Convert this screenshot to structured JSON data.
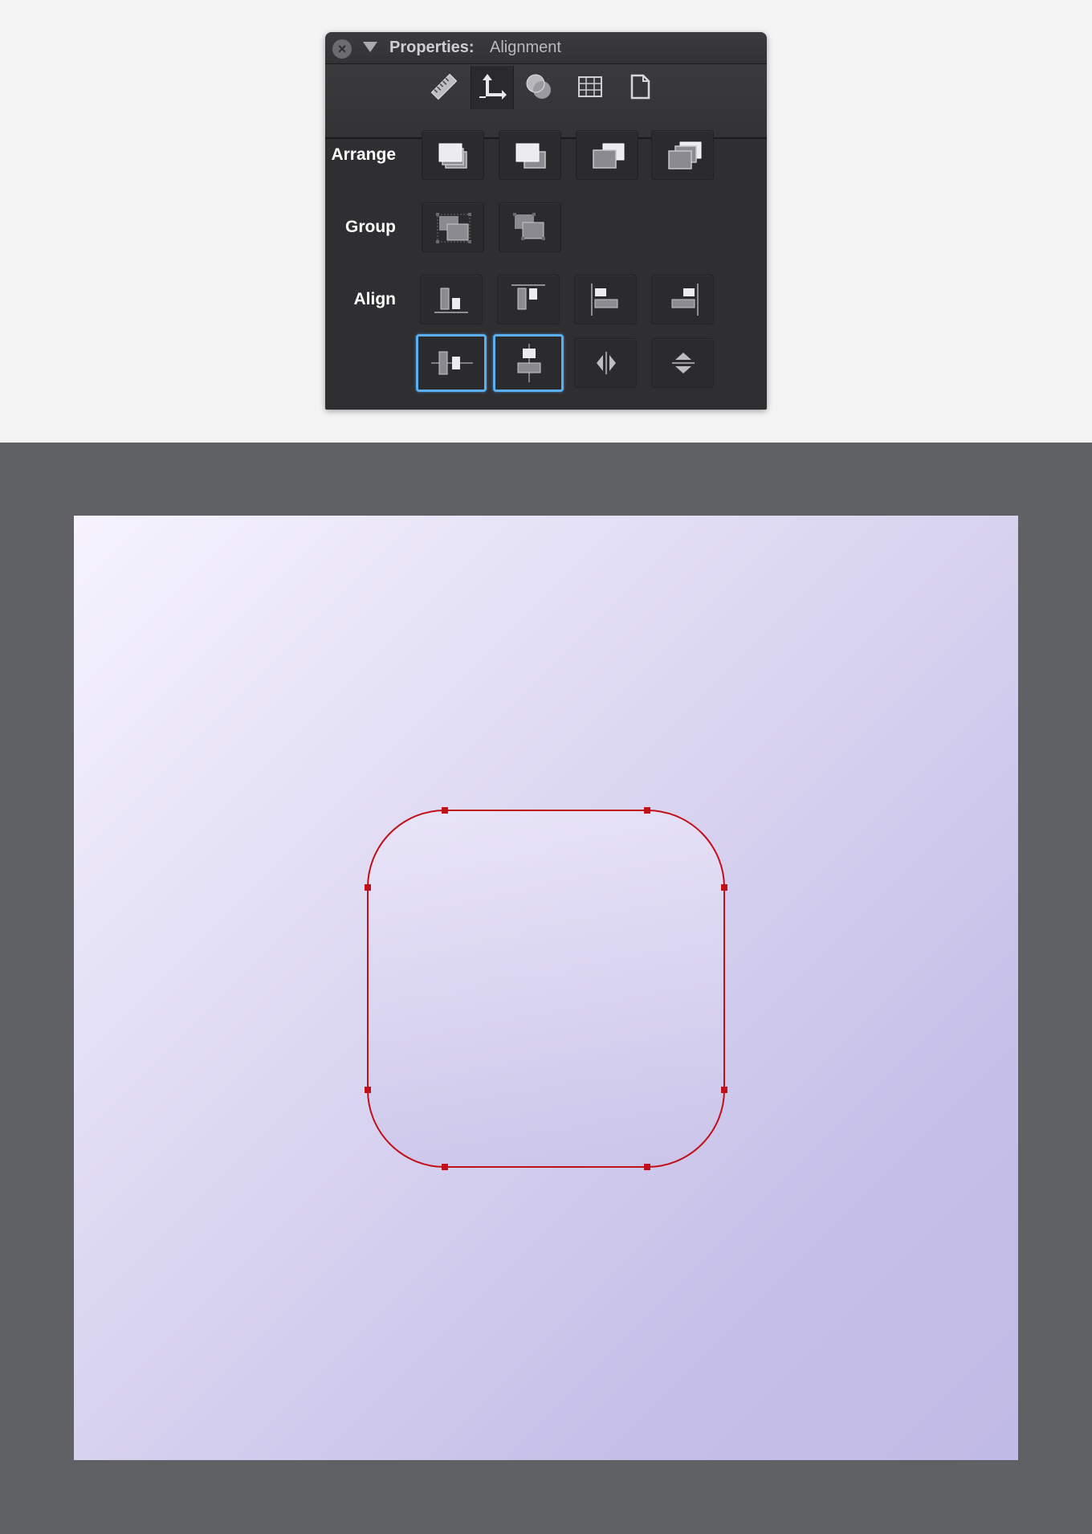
{
  "panel": {
    "title_label": "Properties:",
    "title_value": "Alignment",
    "close_icon": "close-icon",
    "tabs": [
      {
        "name": "ruler-icon",
        "active": false
      },
      {
        "name": "alignment-arrows-icon",
        "active": true
      },
      {
        "name": "shape-combine-icon",
        "active": false
      },
      {
        "name": "grid-icon",
        "active": false
      },
      {
        "name": "document-icon",
        "active": false
      }
    ],
    "rows": {
      "arrange_label": "Arrange",
      "group_label": "Group",
      "align_label": "Align"
    },
    "arrange_buttons": [
      "bring-to-front-icon",
      "bring-forward-icon",
      "send-backward-icon",
      "send-to-back-icon"
    ],
    "group_buttons": [
      "group-icon",
      "ungroup-icon"
    ],
    "align_buttons": [
      "align-bottom-icon",
      "align-top-icon",
      "align-left-icon",
      "align-right-icon"
    ],
    "align_buttons_row2": [
      {
        "name": "align-horizontal-center-icon",
        "selected": true
      },
      {
        "name": "align-vertical-center-icon",
        "selected": true
      },
      {
        "name": "distribute-horizontal-icon",
        "selected": false
      },
      {
        "name": "distribute-vertical-icon",
        "selected": false
      }
    ],
    "selection_color": "#5aaef0"
  },
  "canvas": {
    "background_color": "#606164",
    "artboard_gradient": [
      "#f6f3ff",
      "#c0bae6"
    ],
    "shape": {
      "type": "rounded-rectangle",
      "stroke_color": "#c0101a",
      "selected": true
    }
  }
}
